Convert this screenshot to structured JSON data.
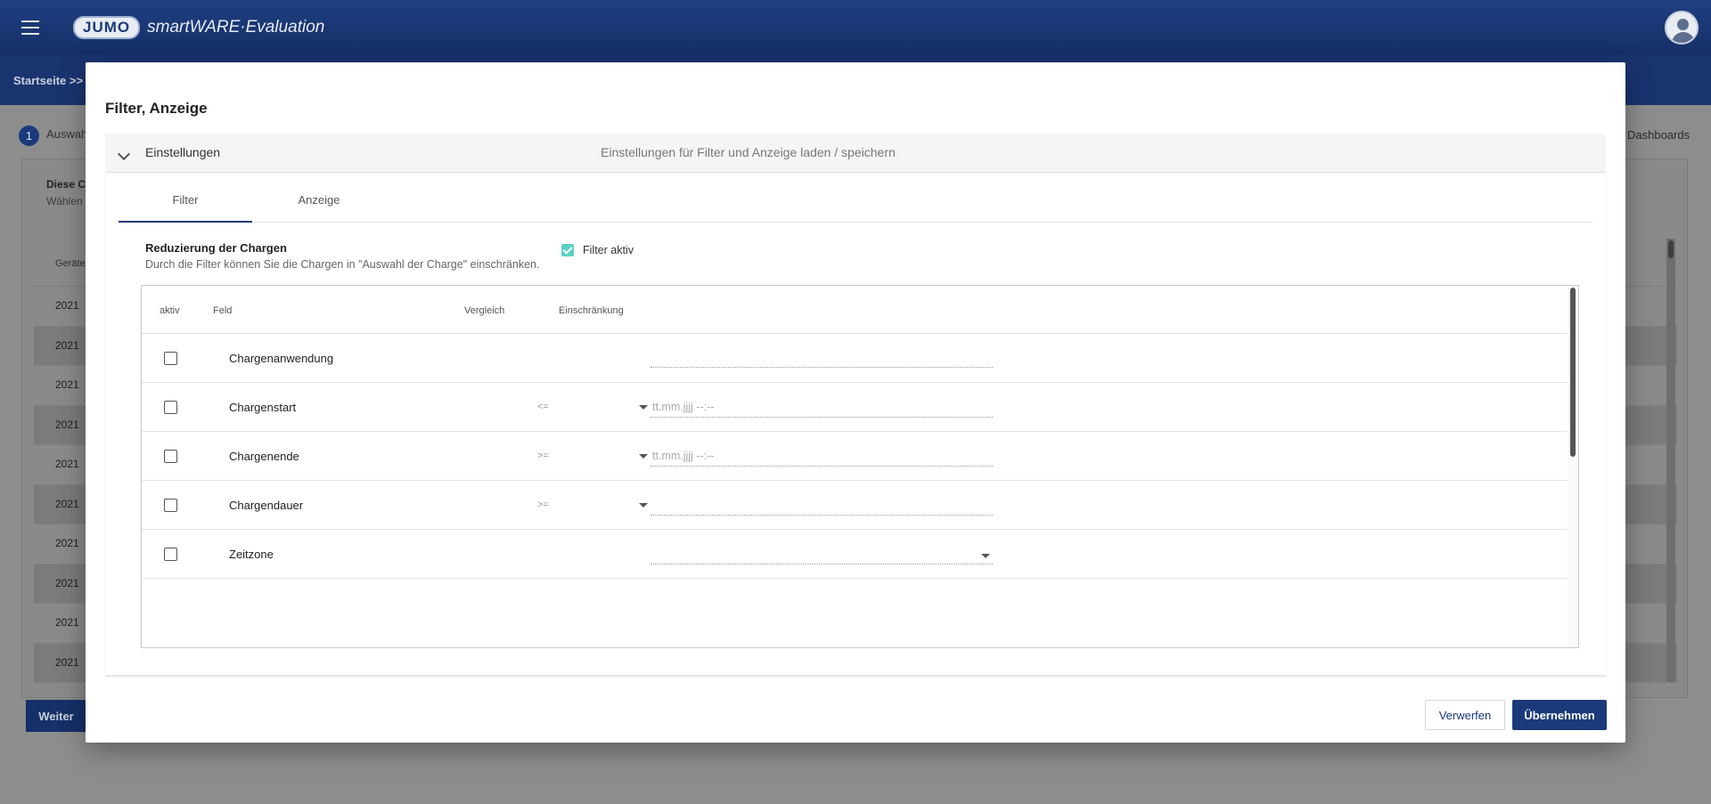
{
  "app": {
    "brand_badge": "JUMO",
    "brand_text": "smartWARE·Evaluation",
    "breadcrumb": "Startseite  >>"
  },
  "background": {
    "step_number": "1",
    "step_label": "Auswah",
    "dashboards_link": "Dashboards",
    "card_title": "Diese C",
    "card_subtitle": "Wählen",
    "table_header": "Geräte",
    "rows": [
      "2021",
      "2021",
      "2021",
      "2021",
      "2021",
      "2021",
      "2021",
      "2021",
      "2021",
      "2021"
    ],
    "weiter_label": "Weiter"
  },
  "modal": {
    "title": "Filter, Anzeige",
    "settings_panel": {
      "title": "Einstellungen",
      "description": "Einstellungen für Filter und Anzeige laden / speichern"
    },
    "tabs": [
      {
        "label": "Filter",
        "active": true
      },
      {
        "label": "Anzeige",
        "active": false
      }
    ],
    "section": {
      "title": "Reduzierung der Chargen",
      "subtitle": "Durch die Filter können Sie die Chargen in \"Auswahl der Charge\" einschränken.",
      "filter_active_label": "Filter aktiv",
      "filter_active_checked": true
    },
    "grid": {
      "headers": {
        "active": "aktiv",
        "field": "Feld",
        "compare": "Vergleich",
        "restriction": "Einschränkung"
      },
      "rows": [
        {
          "field": "Chargenanwendung",
          "compare": "",
          "has_compare_select": false,
          "restriction_placeholder": "",
          "restriction_select": false,
          "checked": false
        },
        {
          "field": "Chargenstart",
          "compare": "<=",
          "has_compare_select": true,
          "restriction_placeholder": "tt.mm.jjjj --:--",
          "restriction_select": false,
          "checked": false
        },
        {
          "field": "Chargenende",
          "compare": ">=",
          "has_compare_select": true,
          "restriction_placeholder": "tt.mm.jjjj --:--",
          "restriction_select": false,
          "checked": false
        },
        {
          "field": "Chargendauer",
          "compare": ">=",
          "has_compare_select": true,
          "restriction_placeholder": "",
          "restriction_select": false,
          "checked": false
        },
        {
          "field": "Zeitzone",
          "compare": "",
          "has_compare_select": false,
          "restriction_placeholder": "",
          "restriction_select": true,
          "checked": false
        }
      ]
    },
    "buttons": {
      "discard": "Verwerfen",
      "apply": "Übernehmen"
    }
  }
}
